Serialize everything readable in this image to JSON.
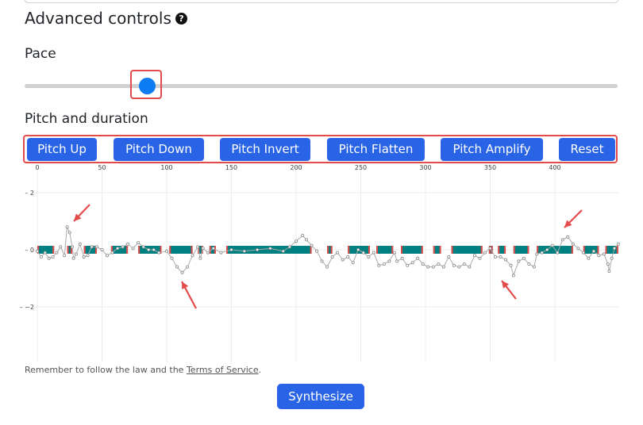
{
  "section": {
    "title": "Advanced controls",
    "help_icon": "question-circle-icon"
  },
  "pace": {
    "label": "Pace",
    "value_fraction": 0.19
  },
  "pitch": {
    "label": "Pitch and duration",
    "buttons": [
      "Pitch Up",
      "Pitch Down",
      "Pitch Invert",
      "Pitch Flatten",
      "Pitch Amplify",
      "Reset"
    ]
  },
  "chart_data": {
    "type": "line",
    "x_ticks": [
      "0",
      "50",
      "100",
      "150",
      "200",
      "250",
      "300",
      "350",
      "400"
    ],
    "y_ticks": [
      "2",
      "0",
      "−2"
    ],
    "xlim": [
      0,
      450
    ],
    "ylim": [
      -3.8,
      2.4
    ],
    "grid": true,
    "bar_color": "#008080",
    "segment_marker_color": "#e34b4b",
    "line_color": "#aaaaaa",
    "segments": [
      [
        0,
        13
      ],
      [
        23,
        27
      ],
      [
        36,
        46
      ],
      [
        57,
        70
      ],
      [
        78,
        96
      ],
      [
        102,
        120
      ],
      [
        124,
        128
      ],
      [
        133,
        138
      ],
      [
        146,
        212
      ],
      [
        224,
        228
      ],
      [
        240,
        257
      ],
      [
        262,
        275
      ],
      [
        281,
        298
      ],
      [
        306,
        312
      ],
      [
        320,
        344
      ],
      [
        349,
        352
      ],
      [
        356,
        362
      ],
      [
        368,
        380
      ],
      [
        386,
        414
      ],
      [
        422,
        434
      ],
      [
        439,
        449
      ]
    ],
    "pitch_points": [
      [
        0,
        -0.05
      ],
      [
        3,
        -0.25
      ],
      [
        6,
        -0.1
      ],
      [
        9,
        -0.3
      ],
      [
        12,
        -0.25
      ],
      [
        15,
        -0.1
      ],
      [
        18,
        0.1
      ],
      [
        21,
        -0.2
      ],
      [
        23,
        0.8
      ],
      [
        25,
        0.6
      ],
      [
        27,
        0.1
      ],
      [
        28,
        -0.3
      ],
      [
        30,
        -0.15
      ],
      [
        33,
        0.2
      ],
      [
        36,
        -0.25
      ],
      [
        39,
        -0.2
      ],
      [
        42,
        0.1
      ],
      [
        46,
        0.1
      ],
      [
        50,
        0.0
      ],
      [
        54,
        -0.2
      ],
      [
        58,
        -0.1
      ],
      [
        62,
        0.05
      ],
      [
        66,
        0.1
      ],
      [
        70,
        0.2
      ],
      [
        74,
        0.05
      ],
      [
        78,
        0.25
      ],
      [
        82,
        0.1
      ],
      [
        86,
        0.0
      ],
      [
        90,
        0.0
      ],
      [
        94,
        -0.1
      ],
      [
        100,
        -0.05
      ],
      [
        104,
        -0.3
      ],
      [
        108,
        -0.6
      ],
      [
        112,
        -0.8
      ],
      [
        116,
        -0.6
      ],
      [
        120,
        -0.2
      ],
      [
        124,
        0.1
      ],
      [
        126,
        -0.3
      ],
      [
        128,
        0.05
      ],
      [
        132,
        -0.1
      ],
      [
        136,
        0.05
      ],
      [
        142,
        -0.1
      ],
      [
        150,
        0.0
      ],
      [
        160,
        -0.05
      ],
      [
        170,
        0.0
      ],
      [
        180,
        0.05
      ],
      [
        190,
        -0.05
      ],
      [
        195,
        0.1
      ],
      [
        200,
        0.3
      ],
      [
        205,
        0.5
      ],
      [
        208,
        0.35
      ],
      [
        212,
        0.15
      ],
      [
        216,
        -0.05
      ],
      [
        220,
        -0.4
      ],
      [
        224,
        -0.6
      ],
      [
        228,
        -0.25
      ],
      [
        232,
        -0.1
      ],
      [
        236,
        -0.35
      ],
      [
        240,
        -0.25
      ],
      [
        244,
        -0.45
      ],
      [
        248,
        0.0
      ],
      [
        252,
        -0.1
      ],
      [
        256,
        -0.25
      ],
      [
        260,
        -0.1
      ],
      [
        264,
        -0.55
      ],
      [
        268,
        -0.5
      ],
      [
        272,
        -0.4
      ],
      [
        276,
        -0.1
      ],
      [
        278,
        -0.4
      ],
      [
        282,
        -0.3
      ],
      [
        286,
        -0.55
      ],
      [
        290,
        -0.45
      ],
      [
        294,
        -0.3
      ],
      [
        298,
        -0.5
      ],
      [
        302,
        -0.6
      ],
      [
        306,
        -0.6
      ],
      [
        310,
        -0.5
      ],
      [
        314,
        -0.6
      ],
      [
        318,
        -0.25
      ],
      [
        322,
        -0.55
      ],
      [
        326,
        -0.6
      ],
      [
        330,
        -0.5
      ],
      [
        334,
        -0.6
      ],
      [
        338,
        -0.2
      ],
      [
        342,
        -0.3
      ],
      [
        346,
        -0.1
      ],
      [
        350,
        0.05
      ],
      [
        354,
        -0.25
      ],
      [
        358,
        -0.25
      ],
      [
        362,
        -0.35
      ],
      [
        366,
        -0.55
      ],
      [
        368,
        -0.9
      ],
      [
        372,
        -0.4
      ],
      [
        376,
        -0.3
      ],
      [
        380,
        -0.5
      ],
      [
        384,
        -0.6
      ],
      [
        386,
        -0.15
      ],
      [
        390,
        -0.1
      ],
      [
        394,
        0.0
      ],
      [
        398,
        0.15
      ],
      [
        402,
        -0.1
      ],
      [
        406,
        0.35
      ],
      [
        410,
        0.45
      ],
      [
        414,
        0.2
      ],
      [
        418,
        0.05
      ],
      [
        422,
        -0.1
      ],
      [
        426,
        -0.3
      ],
      [
        430,
        -0.05
      ],
      [
        434,
        -0.2
      ],
      [
        438,
        -0.15
      ],
      [
        441,
        -0.5
      ],
      [
        442,
        -0.75
      ],
      [
        444,
        -0.3
      ],
      [
        446,
        0.05
      ],
      [
        449,
        0.2
      ]
    ]
  },
  "footer": {
    "text_before": "Remember to follow the law and the ",
    "link_text": "Terms of Service",
    "text_after": "."
  },
  "synthesize_label": "Synthesize"
}
